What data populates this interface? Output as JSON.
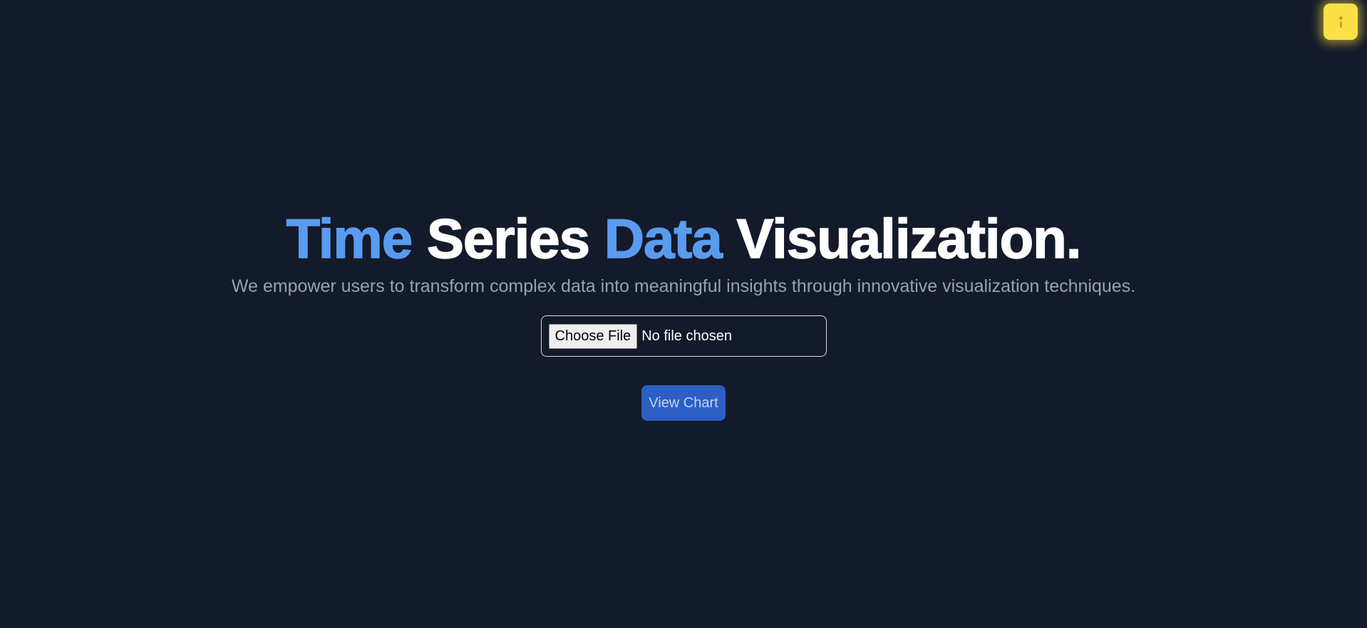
{
  "theme_toggle": {
    "icon": "lightbulb-icon",
    "color": "#fde047"
  },
  "hero": {
    "title_part1": "Time",
    "title_part2": "Series",
    "title_part3": "Data",
    "title_part4": "Visualization.",
    "subtitle": "We empower users to transform complex data into meaningful insights through innovative visualization techniques."
  },
  "upload": {
    "choose_label": "Choose File",
    "status": "No file chosen"
  },
  "actions": {
    "view_chart_label": "View Chart"
  },
  "colors": {
    "background": "#131a2a",
    "accent": "#5a9bf0",
    "button": "#2b5fc4"
  }
}
